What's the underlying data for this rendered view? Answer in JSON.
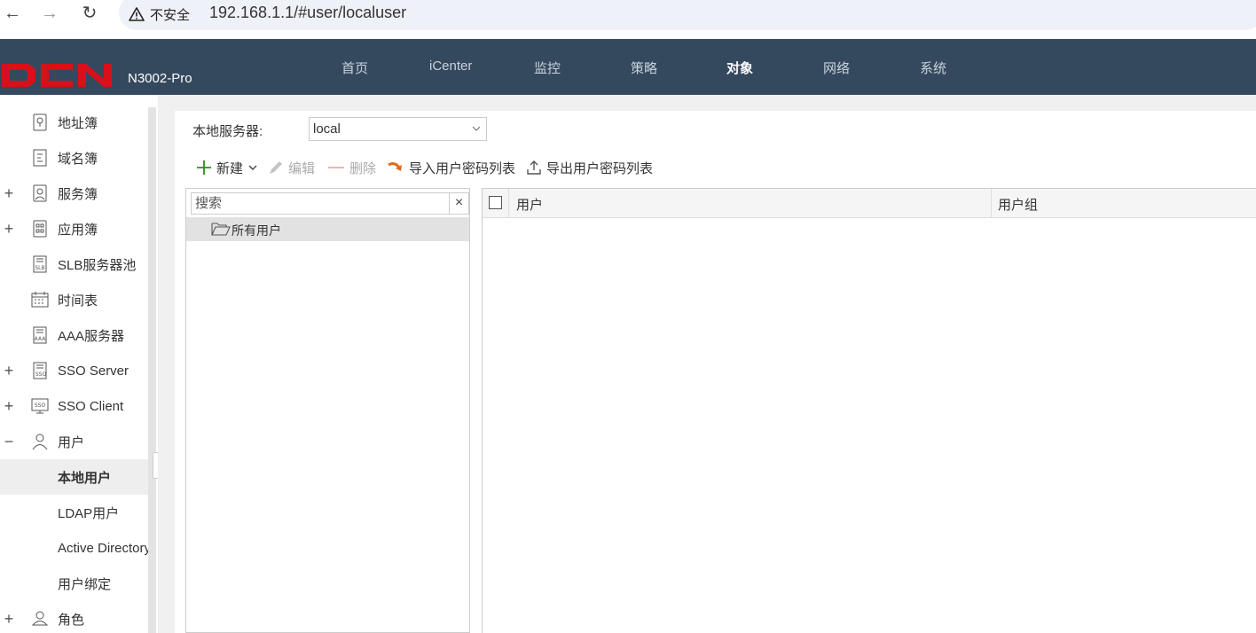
{
  "browser": {
    "security_label": "不安全",
    "url": "192.168.1.1/#user/localuser"
  },
  "header": {
    "logo_text": "DCN",
    "model": "N3002-Pro",
    "nav": [
      {
        "label": "首页",
        "active": false
      },
      {
        "label": "iCenter",
        "active": false
      },
      {
        "label": "监控",
        "active": false
      },
      {
        "label": "策略",
        "active": false
      },
      {
        "label": "对象",
        "active": true
      },
      {
        "label": "网络",
        "active": false
      },
      {
        "label": "系统",
        "active": false
      }
    ]
  },
  "sidebar": {
    "items": [
      {
        "label": "地址簿",
        "icon": "map-pin-icon",
        "expander": ""
      },
      {
        "label": "域名簿",
        "icon": "domain-book-icon",
        "expander": ""
      },
      {
        "label": "服务簿",
        "icon": "service-book-icon",
        "expander": "+"
      },
      {
        "label": "应用簿",
        "icon": "app-book-icon",
        "expander": "+"
      },
      {
        "label": "SLB服务器池",
        "icon": "slb-icon",
        "expander": ""
      },
      {
        "label": "时间表",
        "icon": "calendar-icon",
        "expander": ""
      },
      {
        "label": "AAA服务器",
        "icon": "aaa-server-icon",
        "expander": ""
      },
      {
        "label": "SSO Server",
        "icon": "sso-server-icon",
        "expander": "+"
      },
      {
        "label": "SSO Client",
        "icon": "sso-client-icon",
        "expander": "+"
      },
      {
        "label": "用户",
        "icon": "user-icon",
        "expander": "−"
      },
      {
        "label": "本地用户",
        "icon": "",
        "expander": "",
        "active": true
      },
      {
        "label": "LDAP用户",
        "icon": "",
        "expander": ""
      },
      {
        "label": "Active Directory",
        "icon": "",
        "expander": ""
      },
      {
        "label": "用户绑定",
        "icon": "",
        "expander": ""
      },
      {
        "label": "角色",
        "icon": "role-icon",
        "expander": "+"
      }
    ]
  },
  "main": {
    "server_label": "本地服务器:",
    "server_value": "local",
    "toolbar": {
      "new_label": "新建",
      "edit_label": "编辑",
      "delete_label": "删除",
      "import_label": "导入用户密码列表",
      "export_label": "导出用户密码列表"
    },
    "search_placeholder": "搜索",
    "tree_root": "所有用户",
    "table_headers": {
      "user": "用户",
      "group": "用户组"
    }
  },
  "colors": {
    "header_bg": "#34495e",
    "logo_red": "#d8101a",
    "add_green": "#2e8b1e",
    "import_orange": "#e06a1b"
  }
}
